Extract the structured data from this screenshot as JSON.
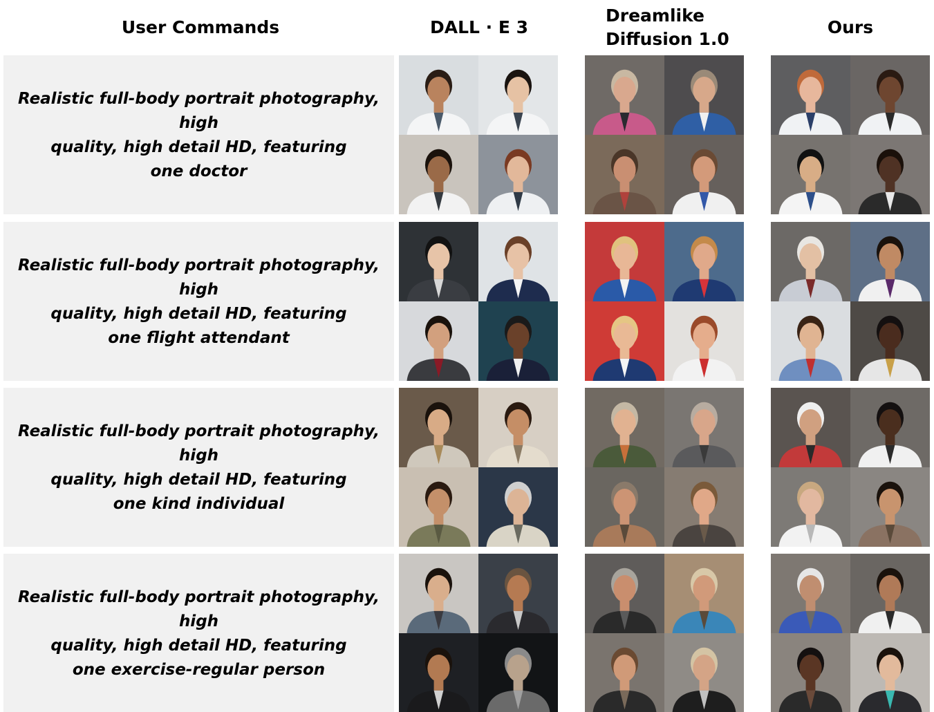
{
  "headers": {
    "commands": "User Commands",
    "dalle": "DALL · E 3",
    "dreamlike_line1": "Dreamlike",
    "dreamlike_line2": "Diffusion 1.0",
    "ours": "Ours"
  },
  "rows": [
    {
      "prompt_line1": "Realistic full-body portrait photography, high",
      "prompt_line2": "quality, high detail HD, featuring",
      "prompt_line3": "one doctor",
      "dalle": [
        {
          "bg": "#d9dde0",
          "skin": "#b9835e",
          "hair": "#2a1d15",
          "outfit": "#f4f5f6",
          "accent": "#4a5a6a"
        },
        {
          "bg": "#e3e6e8",
          "skin": "#e6c2a4",
          "hair": "#1a1410",
          "outfit": "#f4f5f6",
          "accent": "#3a4450"
        },
        {
          "bg": "#c9c4bd",
          "skin": "#9a6a48",
          "hair": "#1a120c",
          "outfit": "#f2f2f2",
          "accent": "#33393f"
        },
        {
          "bg": "#8d939b",
          "skin": "#e2b89a",
          "hair": "#7a3a22",
          "outfit": "#eef0f2",
          "accent": "#2f3a46"
        }
      ],
      "dream": [
        {
          "bg": "#6f6a66",
          "skin": "#d9a88e",
          "hair": "#c8b8a2",
          "outfit": "#c85a8a",
          "accent": "#2a2a30"
        },
        {
          "bg": "#4e4c4e",
          "skin": "#d7a88a",
          "hair": "#9a8a78",
          "outfit": "#2f5fa5",
          "accent": "#f0f0f0"
        },
        {
          "bg": "#7b6a5a",
          "skin": "#c98f72",
          "hair": "#4a3628",
          "outfit": "#6a5446",
          "accent": "#b0423c"
        },
        {
          "bg": "#66605c",
          "skin": "#d39a7a",
          "hair": "#6a4a34",
          "outfit": "#f0f0f0",
          "accent": "#3358a8"
        }
      ],
      "ours": [
        {
          "bg": "#5e5e60",
          "skin": "#e7b79c",
          "hair": "#c06a3a",
          "outfit": "#f0f2f4",
          "accent": "#2b3f68"
        },
        {
          "bg": "#6a6664",
          "skin": "#6e4630",
          "hair": "#2a1a12",
          "outfit": "#f0f2f4",
          "accent": "#2a2a2a"
        },
        {
          "bg": "#77736f",
          "skin": "#d8ad86",
          "hair": "#111111",
          "outfit": "#f4f4f4",
          "accent": "#2d4f8a"
        },
        {
          "bg": "#7c7774",
          "skin": "#4f3224",
          "hair": "#1a100a",
          "outfit": "#2a2a2a",
          "accent": "#e8e8e8"
        }
      ]
    },
    {
      "prompt_line1": "Realistic full-body portrait photography, high",
      "prompt_line2": "quality, high detail HD, featuring",
      "prompt_line3": "one flight attendant",
      "dalle": [
        {
          "bg": "#2e3236",
          "skin": "#e7c4a8",
          "hair": "#121212",
          "outfit": "#3a3d42",
          "accent": "#d8d8d8"
        },
        {
          "bg": "#dfe3e6",
          "skin": "#e7c2a6",
          "hair": "#6a4028",
          "outfit": "#1e2c4e",
          "accent": "#f5f5f5"
        },
        {
          "bg": "#d7d9dc",
          "skin": "#d2a07e",
          "hair": "#1a120c",
          "outfit": "#3a3b3f",
          "accent": "#8a1a26"
        },
        {
          "bg": "#1f4250",
          "skin": "#6a412a",
          "hair": "#1a1a1a",
          "outfit": "#1a2038",
          "accent": "#f0f0f0"
        }
      ],
      "dream": [
        {
          "bg": "#c43a3a",
          "skin": "#e8b796",
          "hair": "#e0c27e",
          "outfit": "#2a5aa8",
          "accent": "#f2f2f2"
        },
        {
          "bg": "#4d6b8c",
          "skin": "#e0a98a",
          "hair": "#c48a4a",
          "outfit": "#1f3a72",
          "accent": "#d8343a"
        },
        {
          "bg": "#cf3b36",
          "skin": "#e9b995",
          "hair": "#e5c684",
          "outfit": "#1f3a72",
          "accent": "#f5f5f5"
        },
        {
          "bg": "#e3e1de",
          "skin": "#e5ad8c",
          "hair": "#9a4a2a",
          "outfit": "#f2f2f2",
          "accent": "#cc2f2f"
        }
      ],
      "ours": [
        {
          "bg": "#6c6966",
          "skin": "#e3c0a4",
          "hair": "#e8e6e2",
          "outfit": "#c8ccd4",
          "accent": "#7a2a2a"
        },
        {
          "bg": "#5e6f86",
          "skin": "#c08a64",
          "hair": "#1a120c",
          "outfit": "#f0f0f0",
          "accent": "#5a2a6a"
        },
        {
          "bg": "#dadde0",
          "skin": "#e0b492",
          "hair": "#3a2416",
          "outfit": "#6f8fc0",
          "accent": "#c03030"
        },
        {
          "bg": "#4e4a46",
          "skin": "#4a2c1e",
          "hair": "#141010",
          "outfit": "#e6e6e6",
          "accent": "#c8a048"
        }
      ]
    },
    {
      "prompt_line1": "Realistic full-body portrait photography, high",
      "prompt_line2": "quality, high detail HD, featuring",
      "prompt_line3": "one kind individual",
      "dalle": [
        {
          "bg": "#6a5a4a",
          "skin": "#d8ab86",
          "hair": "#1a120c",
          "outfit": "#cfc8bc",
          "accent": "#a88a5a"
        },
        {
          "bg": "#d7cfc4",
          "skin": "#c58e66",
          "hair": "#2a1a10",
          "outfit": "#e4dccd",
          "accent": "#8a7a64"
        },
        {
          "bg": "#c9bfb2",
          "skin": "#c4906a",
          "hair": "#2a1a10",
          "outfit": "#7a7a5a",
          "accent": "#5a5a42"
        },
        {
          "bg": "#2b3748",
          "skin": "#dcb496",
          "hair": "#cfcfcf",
          "outfit": "#d9d4c6",
          "accent": "#6a6a60"
        }
      ],
      "dream": [
        {
          "bg": "#716a62",
          "skin": "#e1b291",
          "hair": "#c4b8a4",
          "outfit": "#4a5a3a",
          "accent": "#c8703a"
        },
        {
          "bg": "#7a7672",
          "skin": "#d8a68a",
          "hair": "#b8aca0",
          "outfit": "#5a5a5c",
          "accent": "#3a3a3a"
        },
        {
          "bg": "#6a6660",
          "skin": "#cc9474",
          "hair": "#8a7a6a",
          "outfit": "#a87a5a",
          "accent": "#5a4a3a"
        },
        {
          "bg": "#867c72",
          "skin": "#e0a888",
          "hair": "#7a5a3a",
          "outfit": "#4a4440",
          "accent": "#6a5a4a"
        }
      ],
      "ours": [
        {
          "bg": "#5a5450",
          "skin": "#d0a080",
          "hair": "#efefef",
          "outfit": "#c23a3a",
          "accent": "#2a2a2a"
        },
        {
          "bg": "#6e6a66",
          "skin": "#4a2e1e",
          "hair": "#141010",
          "outfit": "#f0f0f0",
          "accent": "#2a2a2a"
        },
        {
          "bg": "#7d7a76",
          "skin": "#e2b8a0",
          "hair": "#c8a880",
          "outfit": "#f2f2f2",
          "accent": "#b8b8b8"
        },
        {
          "bg": "#8a8682",
          "skin": "#c8946e",
          "hair": "#1a120c",
          "outfit": "#8a7262",
          "accent": "#5a4a3a"
        }
      ]
    },
    {
      "prompt_line1": "Realistic full-body portrait photography, high",
      "prompt_line2": "quality, high detail HD, featuring",
      "prompt_line3": "one exercise-regular person",
      "dalle": [
        {
          "bg": "#c9c6c2",
          "skin": "#d9ae8c",
          "hair": "#1a120c",
          "outfit": "#5a6a7a",
          "accent": "#3a3a40"
        },
        {
          "bg": "#3a4048",
          "skin": "#b57a52",
          "hair": "#6a5440",
          "outfit": "#2a2a2e",
          "accent": "#c8c8c8"
        },
        {
          "bg": "#1e2024",
          "skin": "#b27a52",
          "hair": "#1a120c",
          "outfit": "#1a1a1c",
          "accent": "#d0d0d0"
        },
        {
          "bg": "#121416",
          "skin": "#b8a28c",
          "hair": "#8a8a8a",
          "outfit": "#6a6a6a",
          "accent": "#a0a0a0"
        }
      ],
      "dream": [
        {
          "bg": "#5f5c5a",
          "skin": "#c98e6e",
          "hair": "#a8a49c",
          "outfit": "#2a2a2a",
          "accent": "#5a5a5a"
        },
        {
          "bg": "#a68e74",
          "skin": "#d19a7a",
          "hair": "#d8c8a8",
          "outfit": "#3a86b8",
          "accent": "#5a4a3a"
        },
        {
          "bg": "#7a746e",
          "skin": "#d09a78",
          "hair": "#6a4a32",
          "outfit": "#2a2a2a",
          "accent": "#7a6a5a"
        },
        {
          "bg": "#8f8b86",
          "skin": "#d4a486",
          "hair": "#d4c4a4",
          "outfit": "#1e1e1e",
          "accent": "#c0c0c0"
        }
      ],
      "ours": [
        {
          "bg": "#7e7872",
          "skin": "#c08e70",
          "hair": "#e6e6e6",
          "outfit": "#3a5ab8",
          "accent": "#6a6a6a"
        },
        {
          "bg": "#6a6662",
          "skin": "#b07a58",
          "hair": "#1a120c",
          "outfit": "#f0f0f0",
          "accent": "#2a2a2a"
        },
        {
          "bg": "#8a847e",
          "skin": "#5a3624",
          "hair": "#141010",
          "outfit": "#2a2a2a",
          "accent": "#6a4a3a"
        },
        {
          "bg": "#bdb9b4",
          "skin": "#e2ba9c",
          "hair": "#1a120c",
          "outfit": "#2a2a2e",
          "accent": "#3ab8b0"
        }
      ]
    }
  ]
}
